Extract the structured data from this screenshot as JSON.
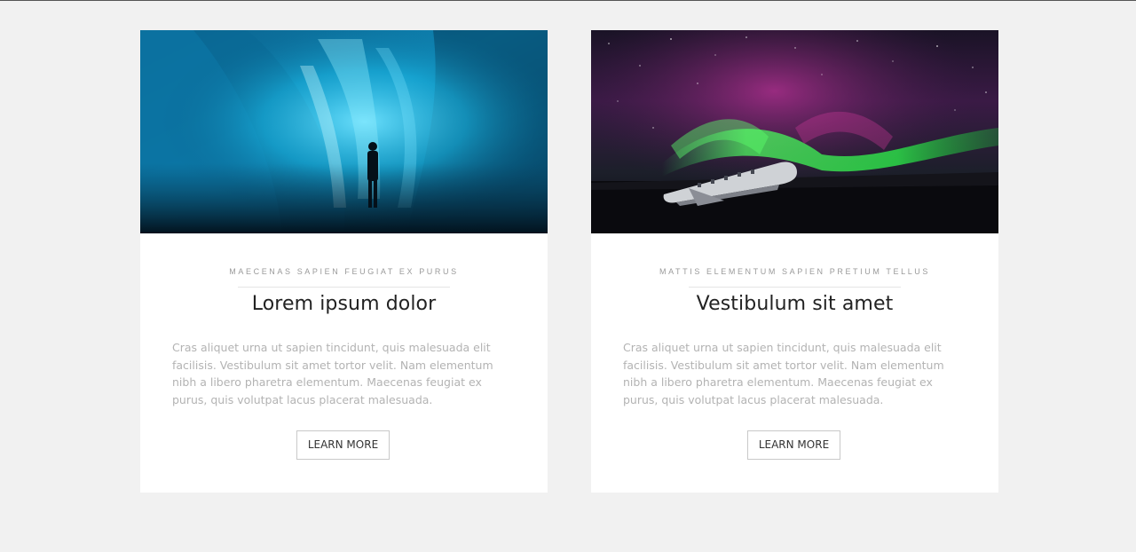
{
  "cards": [
    {
      "kicker": "MAECENAS SAPIEN FEUGIAT EX PURUS",
      "title": "Lorem ipsum dolor",
      "body": "Cras aliquet urna ut sapien tincidunt, quis malesuada elit facilisis. Vestibulum sit amet tortor velit. Nam elementum nibh a libero pharetra elementum. Maecenas feugiat ex purus, quis volutpat lacus placerat malesuada.",
      "button_label": "LEARN MORE",
      "image": "ice-cave-photo"
    },
    {
      "kicker": "MATTIS ELEMENTUM SAPIEN PRETIUM TELLUS",
      "title": "Vestibulum sit amet",
      "body": "Cras aliquet urna ut sapien tincidunt, quis malesuada elit facilisis. Vestibulum sit amet tortor velit. Nam elementum nibh a libero pharetra elementum. Maecenas feugiat ex purus, quis volutpat lacus placerat malesuada.",
      "button_label": "LEARN MORE",
      "image": "aurora-plane-wreck-photo"
    }
  ],
  "colors": {
    "page_background": "#f1f1f1",
    "card_background": "#ffffff",
    "title_text": "#222222",
    "body_text": "#b3b3b3",
    "kicker_text": "#9a9a9a",
    "button_border": "#c9c9c9"
  }
}
